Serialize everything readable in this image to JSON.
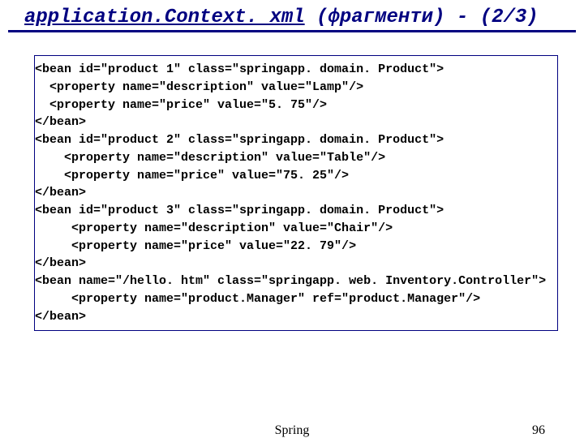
{
  "title": {
    "filename": "application.Context. xml",
    "suffix": " (фрагменти) - (2/3)"
  },
  "code": {
    "l1": "<bean id=\"product 1\" class=\"springapp. domain. Product\">",
    "l2": "  <property name=\"description\" value=\"Lamp\"/>",
    "l3": "  <property name=\"price\" value=\"5. 75\"/>",
    "l4": "</bean>",
    "l5": "<bean id=\"product 2\" class=\"springapp. domain. Product\">",
    "l6": "    <property name=\"description\" value=\"Table\"/>",
    "l7": "    <property name=\"price\" value=\"75. 25\"/>",
    "l8": "</bean>",
    "l9": "<bean id=\"product 3\" class=\"springapp. domain. Product\">",
    "l10": "     <property name=\"description\" value=\"Chair\"/>",
    "l11": "     <property name=\"price\" value=\"22. 79\"/>",
    "l12": "</bean>",
    "l13": "<bean name=\"/hello. htm\" class=\"springapp. web. Inventory.Controller\">",
    "l14": "     <property name=\"product.Manager\" ref=\"product.Manager\"/>",
    "l15": "</bean>"
  },
  "footer": {
    "center": "Spring",
    "page": "96"
  }
}
